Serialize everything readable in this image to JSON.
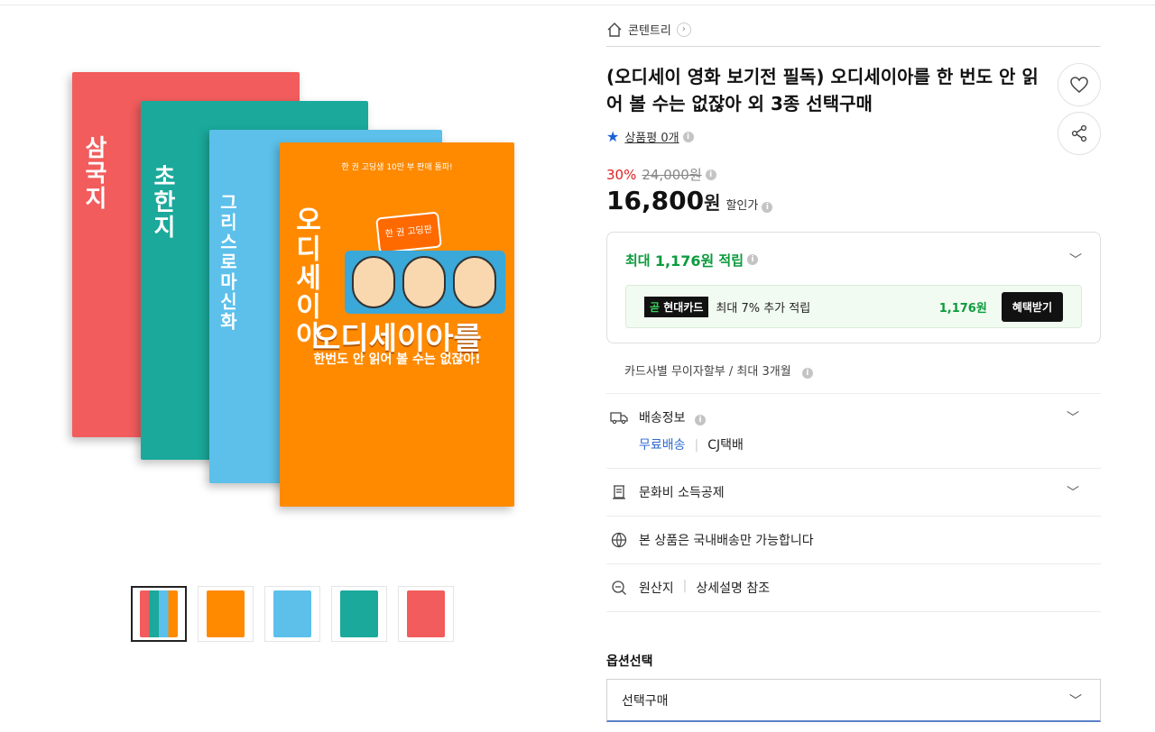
{
  "gallery": {
    "books": [
      {
        "spine": "삼국지",
        "color": "#f25c5c"
      },
      {
        "spine": "초한지",
        "color": "#1aa99b"
      },
      {
        "spine": "그리스로마신화",
        "color": "#5cc0ea"
      },
      {
        "spine": "오디세이아",
        "color": "#ff8a00"
      }
    ],
    "front_cover": {
      "top_line": "한 권 고딩생 10만 부 판매 돌파!",
      "badge": "한 권 고딩판",
      "title": "오디세이아를",
      "subtitle": "한번도 안 읽어 볼 수는 없잖아!"
    },
    "thumbnails": [
      {
        "color": "#1aa99b",
        "active": true
      },
      {
        "color": "#ff8a00",
        "active": false
      },
      {
        "color": "#5cc0ea",
        "active": false
      },
      {
        "color": "#1aa99b",
        "active": false
      },
      {
        "color": "#f25c5c",
        "active": false
      }
    ]
  },
  "breadcrumb": {
    "label": "콘텐트리"
  },
  "product": {
    "title": "(오디세이 영화 보기전 필독) 오디세이아를 한 번도 안 읽어 볼 수는 없잖아 외 3종 선택구매",
    "review_label": "상품평 0개",
    "discount_rate": "30%",
    "original_price": "24,000원",
    "sale_price": "16,800",
    "won": "원",
    "sale_label": "할인가"
  },
  "points": {
    "prefix": "최대",
    "amount": "1,176원",
    "suffix": "적립",
    "card_logo_g": "곧",
    "card_logo_name": "현대카드",
    "card_text": "최대 7% 추가 적립",
    "card_amount": "1,176원",
    "card_button": "혜택받기"
  },
  "installment": "카드사별 무이자할부 / 최대 3개월",
  "delivery": {
    "label": "배송정보",
    "free": "무료배송",
    "courier": "CJ택배"
  },
  "culture": {
    "label": "문화비 소득공제"
  },
  "domestic": {
    "label": "본 상품은 국내배송만 가능합니다"
  },
  "origin": {
    "label": "원산지",
    "value": "상세설명 참조"
  },
  "option": {
    "label": "옵션선택",
    "selected": "선택구매"
  }
}
